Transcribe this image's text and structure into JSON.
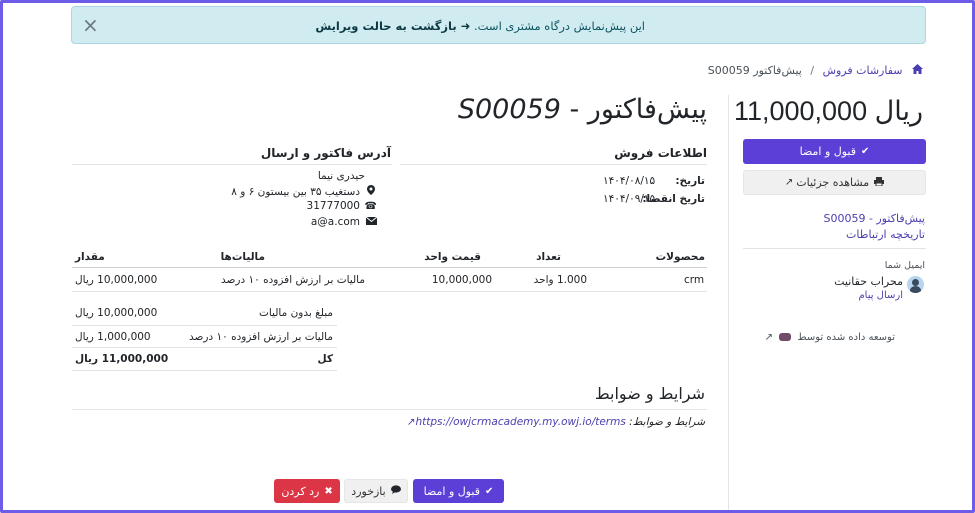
{
  "alert": {
    "text": "این پیش‌نمایش درگاه مشتری است.",
    "link_arrow": "➜",
    "link": "بازگشت به حالت ویرایش",
    "close": "×"
  },
  "breadcrumb": {
    "items": [
      "سفارشات فروش",
      "پیش‌فاکتور S00059"
    ],
    "separator": "/"
  },
  "sidebar": {
    "amount": "11,000,000 ریال",
    "accept_button": "قبول و امضا",
    "details_button": "مشاهده جزئیات",
    "doc_link": "پیش‌فاکتور - S00059",
    "history_link": "تاریخچه ارتباطات",
    "email_label": "ایمیل شما",
    "contact_name": "محراب حقانیت",
    "send_message": "ارسال پیام",
    "powered_by": "توسعه داده شده توسط"
  },
  "main": {
    "title_prefix": "پیش‌فاکتور - ",
    "title_number": "S00059",
    "sales_info": {
      "heading": "اطلاعات فروش",
      "date_label": "تاریخ:",
      "date_value": "۱۴۰۴/۰۸/۱۵",
      "expiry_label": "تاریخ انقضا:",
      "expiry_value": "۱۴۰۴/۰۹/۱۵"
    },
    "address": {
      "heading": "آدرس فاکتور و ارسال",
      "name": "حیدری نیما",
      "street": "دستغیب ۳۵ بین بیستون ۶ و ۸",
      "phone": "31777000",
      "email": "a@a.com"
    },
    "table": {
      "headers": [
        "محصولات",
        "تعداد",
        "قیمت واحد",
        "مالیات‌ها",
        "مقدار"
      ],
      "rows": [
        [
          "crm",
          "1.000 واحد",
          "10,000,000",
          "مالیات بر ارزش افزوده ۱۰ درصد",
          "10,000,000 ریال"
        ]
      ]
    },
    "summary": {
      "untaxed_label": "مبلغ بدون مالیات",
      "untaxed_value": "10,000,000 ریال",
      "tax_label": "مالیات بر ارزش افزوده ۱۰ درصد",
      "tax_value": "1,000,000 ریال",
      "total_label": "کل",
      "total_value": "11,000,000 ریال"
    },
    "terms": {
      "heading": "شرایط و ضوابط",
      "label": "شرایط و ضوابط:",
      "url": "https://owjcrmacademy.my.owj.io/terms"
    },
    "actions": {
      "accept": "قبول و امضا",
      "feedback": "بازخورد",
      "reject": "رد کردن"
    }
  },
  "colors": {
    "primary": "#5b3fd6",
    "danger": "#dc3545",
    "alert_bg": "#d1ecf1",
    "link": "#4a3fb0",
    "frame": "#6c5ce7"
  }
}
